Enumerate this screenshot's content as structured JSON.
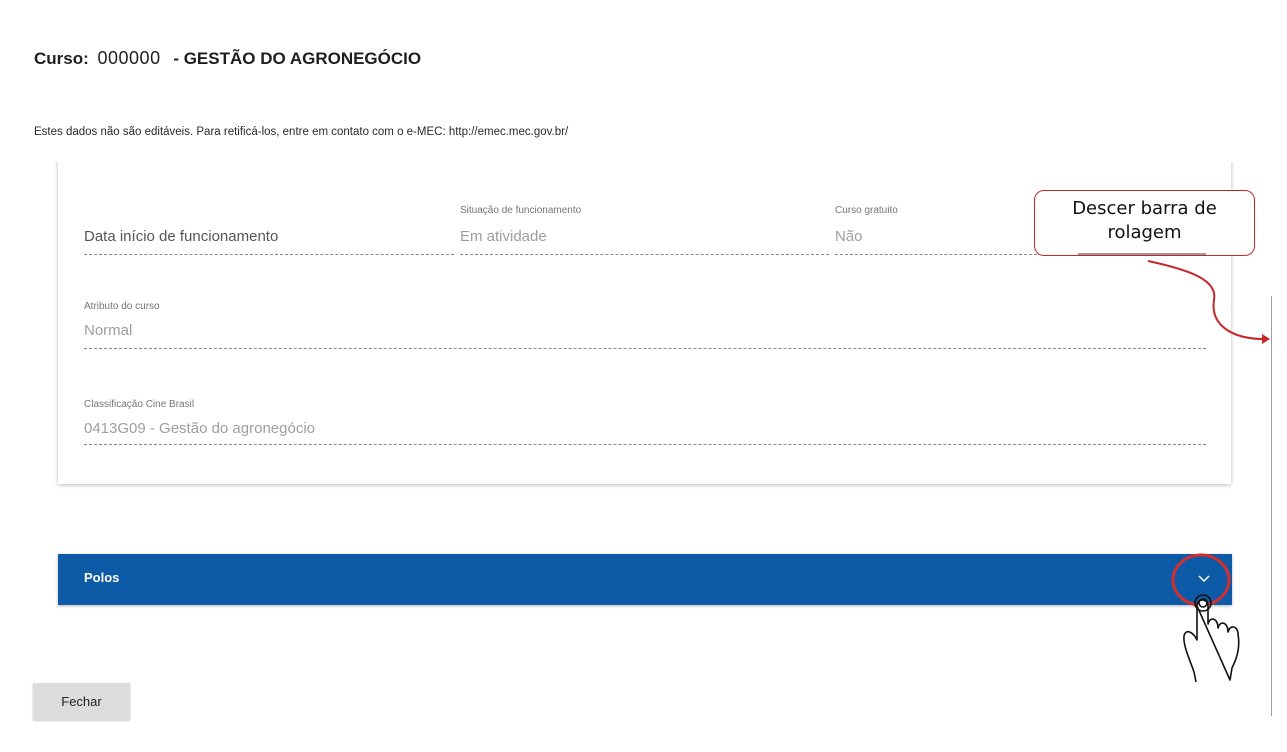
{
  "header": {
    "label": "Curso:",
    "code": "000000",
    "name": "- GESTÃO DO AGRONEGÓCIO"
  },
  "notice": "Estes dados não são editáveis. Para retificá-los, entre em contato com o e-MEC: http://emec.mec.gov.br/",
  "fields": {
    "data_inicio": {
      "label": "",
      "placeholder": "Data início de funcionamento"
    },
    "situacao": {
      "label": "Situação de funcionamento",
      "value": "Em atividade"
    },
    "gratuito": {
      "label": "Curso gratuito",
      "value": "Não"
    },
    "atributo": {
      "label": "Atributo do curso",
      "value": "Normal"
    },
    "cine": {
      "label": "Classificação Cine Brasil",
      "value": "0413G09 - Gestão do agronegócio"
    }
  },
  "polos": {
    "label": "Polos",
    "accent": "#0d5aa7"
  },
  "buttons": {
    "close": "Fechar"
  },
  "annotation": {
    "line1": "Descer barra de",
    "line2": "rolagem",
    "color": "#c62828"
  }
}
